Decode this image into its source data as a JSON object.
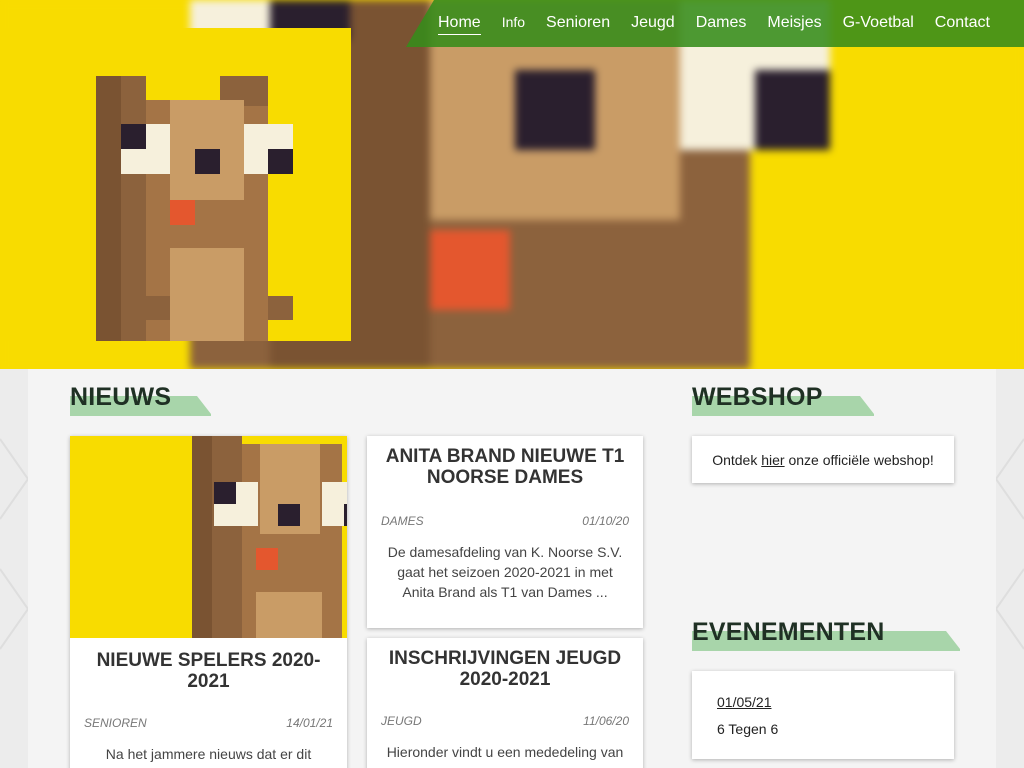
{
  "nav": {
    "items": [
      "Home",
      "Info",
      "Senioren",
      "Jeugd",
      "Dames",
      "Meisjes",
      "G-Voetbal",
      "Contact"
    ]
  },
  "news": {
    "title": "NIEUWS",
    "articles": [
      {
        "title": "ANITA BRAND NIEUWE T1 NOORSE DAMES",
        "category": "DAMES",
        "date": "01/10/20",
        "excerpt": "De damesafdeling van K. Noorse S.V. gaat het seizoen 2020-2021 in met Anita Brand als T1 van Dames ..."
      },
      {
        "title": "NIEUWE SPELERS 2020-2021",
        "category": "SENIOREN",
        "date": "14/01/21",
        "excerpt": "Na het jammere nieuws dat er dit"
      },
      {
        "title": "INSCHRIJVINGEN JEUGD 2020-2021",
        "category": "JEUGD",
        "date": "11/06/20",
        "excerpt": "Hieronder vindt u een mededeling van"
      }
    ]
  },
  "webshop": {
    "title": "WEBSHOP",
    "text_before": "Ontdek ",
    "link": "hier",
    "text_after": " onze officiële webshop!"
  },
  "events": {
    "title": "EVENEMENTEN",
    "items": [
      {
        "date": "01/05/21",
        "name": "6 Tegen 6"
      }
    ]
  },
  "colors": {
    "yellow": "#f8dc00",
    "green": "#368c1a",
    "accent": "#a8d5aa"
  }
}
